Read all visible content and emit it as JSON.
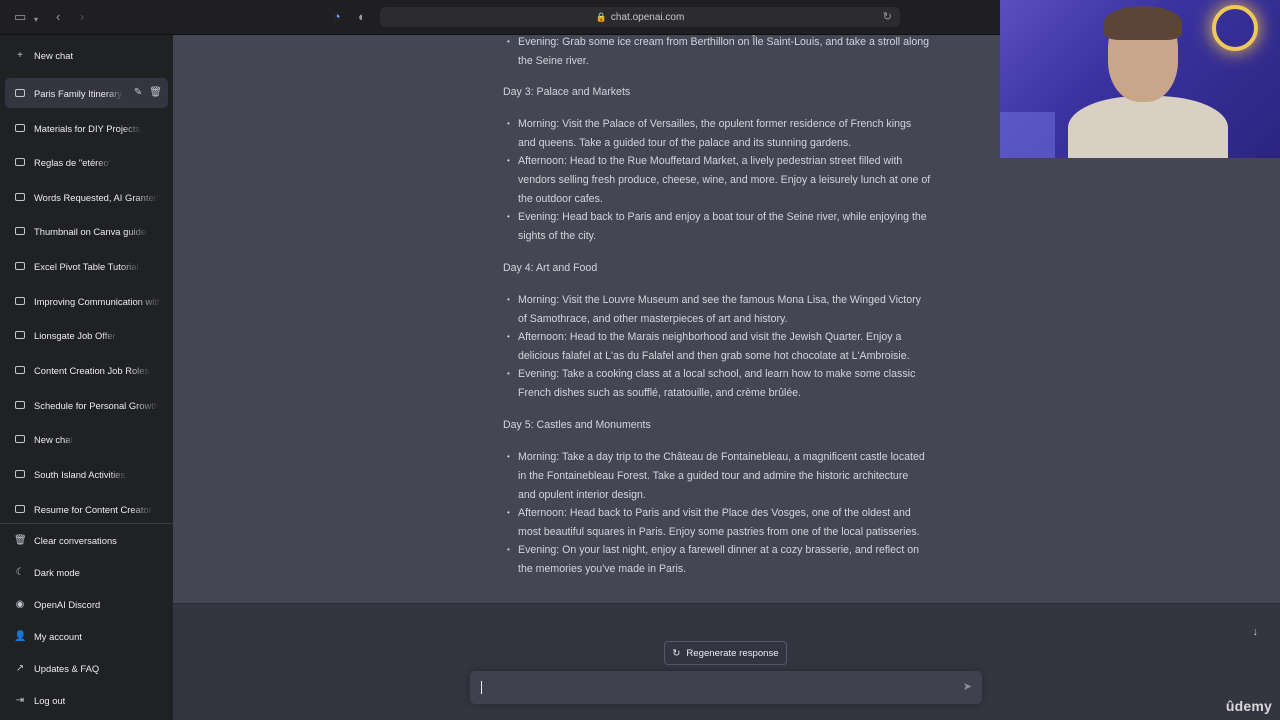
{
  "browser": {
    "url": "chat.openai.com"
  },
  "sidebar": {
    "new_chat_top": "New chat",
    "conversations": [
      {
        "label": "Paris Family Itinerary.",
        "active": true
      },
      {
        "label": "Materials for DIY Projects."
      },
      {
        "label": "Reglas de \"etéreo\""
      },
      {
        "label": "Words Requested, AI Granted"
      },
      {
        "label": "Thumbnail on Canva guide."
      },
      {
        "label": "Excel Pivot Table Tutorial."
      },
      {
        "label": "Improving Communication with"
      },
      {
        "label": "Lionsgate Job Offer."
      },
      {
        "label": "Content Creation Job Roles."
      },
      {
        "label": "Schedule for Personal Growth"
      },
      {
        "label": "New chat"
      },
      {
        "label": "South Island Activities."
      },
      {
        "label": "Resume for Content Creator."
      }
    ],
    "bottom": {
      "clear": "Clear conversations",
      "dark_mode": "Dark mode",
      "discord": "OpenAI Discord",
      "account": "My account",
      "updates": "Updates & FAQ",
      "logout": "Log out"
    }
  },
  "chat": {
    "top_bullet": [
      "Evening: Grab some ice cream from Berthillon on Île Saint-Louis, and take a stroll along",
      "the Seine river."
    ],
    "days": [
      {
        "title": "Day 3: Palace and Markets",
        "bullets": [
          [
            "Morning: Visit the Palace of Versailles, the opulent former residence of French kings",
            "and queens. Take a guided tour of the palace and its stunning gardens."
          ],
          [
            "Afternoon: Head to the Rue Mouffetard Market, a lively pedestrian street filled with",
            "vendors selling fresh produce, cheese, wine, and more. Enjoy a leisurely lunch at one of",
            "the outdoor cafes."
          ],
          [
            "Evening: Head back to Paris and enjoy a boat tour of the Seine river, while enjoying the",
            "sights of the city."
          ]
        ]
      },
      {
        "title": "Day 4: Art and Food",
        "bullets": [
          [
            "Morning: Visit the Louvre Museum and see the famous Mona Lisa, the Winged Victory",
            "of Samothrace, and other masterpieces of art and history."
          ],
          [
            "Afternoon: Head to the Marais neighborhood and visit the Jewish Quarter. Enjoy a",
            "delicious falafel at L'as du Falafel and then grab some hot chocolate at L'Ambroisie."
          ],
          [
            "Evening: Take a cooking class at a local school, and learn how to make some classic",
            "French dishes such as soufflé, ratatouille, and crème brûlée."
          ]
        ]
      },
      {
        "title": "Day 5: Castles and Monuments",
        "bullets": [
          [
            "Morning: Take a day trip to the Château de Fontainebleau, a magnificent castle located",
            "in the Fontainebleau Forest. Take a guided tour and admire the historic architecture",
            "and opulent interior design."
          ],
          [
            "Afternoon: Head back to Paris and visit the Place des Vosges, one of the oldest and",
            "most beautiful squares in Paris. Enjoy some pastries from one of the local patisseries."
          ],
          [
            "Evening: On your last night, enjoy a farewell dinner at a cozy brasserie, and reflect on",
            "the memories you've made in Paris."
          ]
        ]
      }
    ]
  },
  "composer": {
    "regenerate_label": "Regenerate response"
  },
  "watermark": "ûdemy"
}
